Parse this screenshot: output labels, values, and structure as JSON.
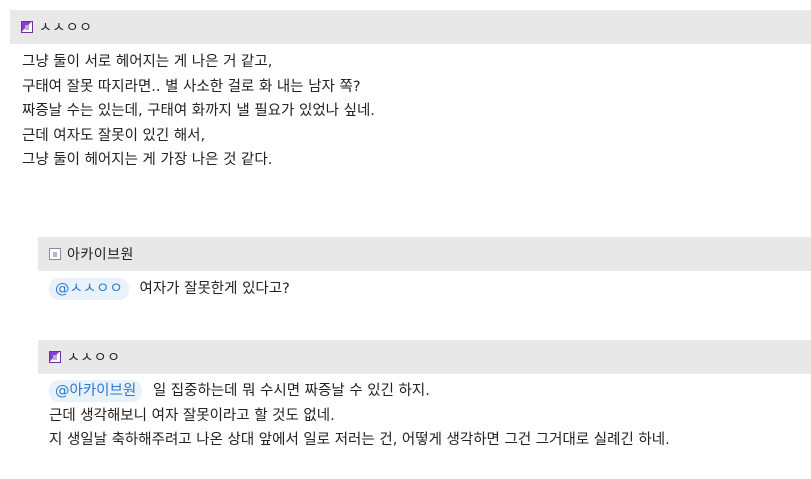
{
  "comments": [
    {
      "author": "ㅅㅅㅇㅇ",
      "level_icon": "level-badge-purple-icon",
      "mention": "",
      "lines": [
        "그냥 둘이 서로 헤어지는 게 나은 거 같고,",
        "구태여 잘못 따지라면.. 별 사소한 걸로 화 내는 남자 쪽?",
        "짜증날 수는 있는데, 구태여 화까지 낼 필요가 있었나 싶네.",
        "근데 여자도 잘못이 있긴 해서,",
        "그냥 둘이 헤어지는 게 가장 나은 것 같다."
      ]
    },
    {
      "author": "아카이브원",
      "level_icon": "level-badge-icon",
      "mention": "@ㅅㅅㅇㅇ",
      "lines": [
        "여자가 잘못한게 있다고?"
      ]
    },
    {
      "author": "ㅅㅅㅇㅇ",
      "level_icon": "level-badge-purple-icon",
      "mention": "@아카이브원",
      "lines": [
        "일 집중하는데 뭐 수시면 짜증날 수 있긴 하지.",
        "근데 생각해보니 여자 잘못이라고 할 것도 없네.",
        "지 생일날 축하해주려고 나온 상대 앞에서 일로 저러는 건, 어떻게 생각하면 그건 그거대로 실례긴 하네."
      ]
    }
  ],
  "colors": {
    "header_bg": "#e8e8e8",
    "mention_text": "#2a7ad1",
    "mention_bg": "#e9f1fb",
    "badge_purple": "#8a3bd6"
  }
}
